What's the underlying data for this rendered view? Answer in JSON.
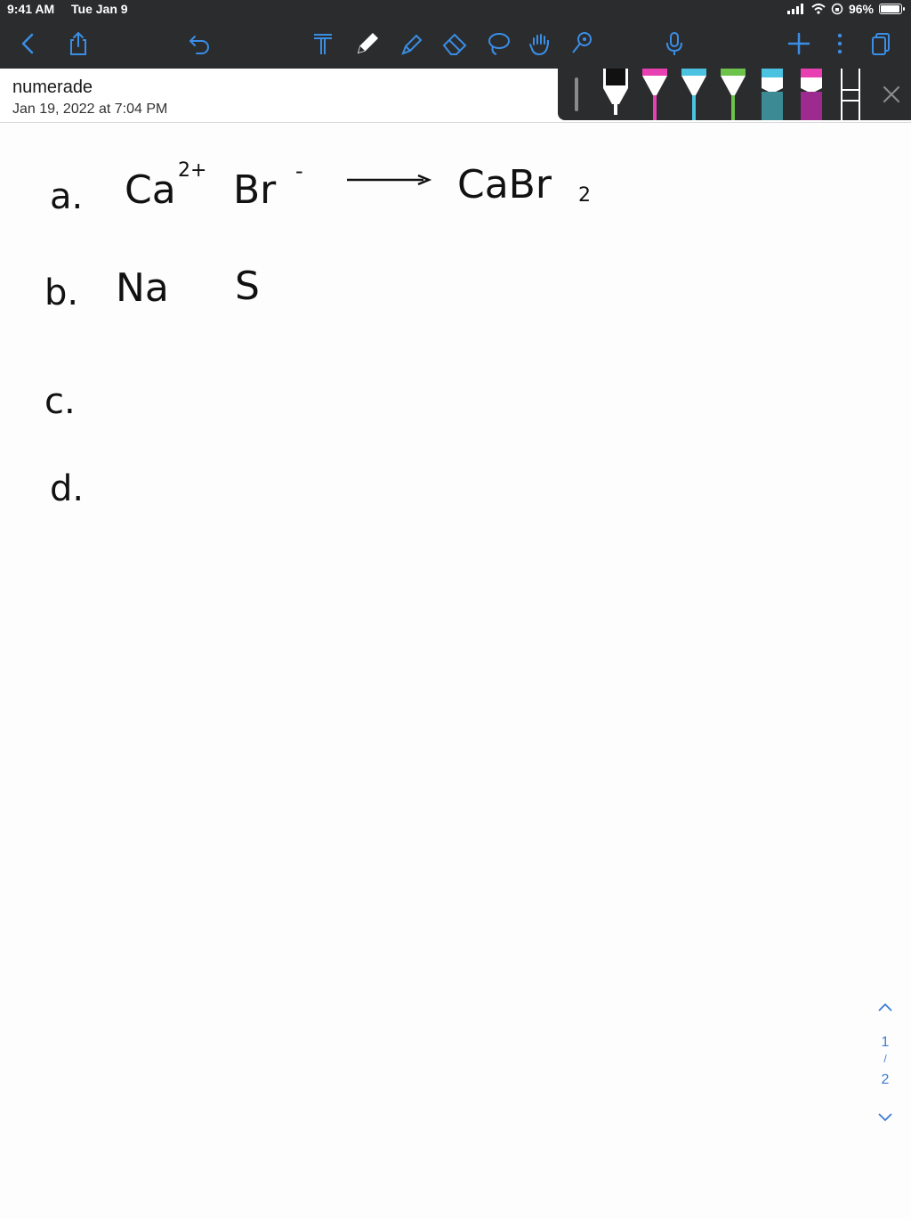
{
  "status_bar": {
    "time": "9:41 AM",
    "date": "Tue Jan 9",
    "battery": "96%",
    "battery_level": 0.96
  },
  "toolbar": {
    "icons": [
      "back-icon",
      "share-icon",
      "undo-icon",
      "text-tool-icon",
      "pen-icon",
      "highlighter-icon",
      "eraser-icon",
      "lasso-icon",
      "hand-icon",
      "shapes-icon",
      "microphone-icon",
      "add-icon",
      "more-icon",
      "pages-icon"
    ]
  },
  "document": {
    "title": "numerade",
    "date": "Jan 19, 2022 at 7:04 PM"
  },
  "pen_tray": {
    "colors": [
      "#111111",
      "#e83fb3",
      "#4bc2e0",
      "#6dc24b",
      "#3b8a94",
      "#9c2a8f",
      "#ffffff"
    ]
  },
  "canvas": {
    "line_a": {
      "label": "a.",
      "ion1": "Ca",
      "charge1": "2+",
      "ion2": "Br",
      "charge2": "-",
      "product": "CaBr",
      "subscript": "2"
    },
    "line_b": {
      "label": "b.",
      "ion1": "Na",
      "ion2": "S"
    },
    "line_c": {
      "label": "c."
    },
    "line_d": {
      "label": "d."
    }
  },
  "page_nav": {
    "current": "1",
    "total": "2"
  }
}
